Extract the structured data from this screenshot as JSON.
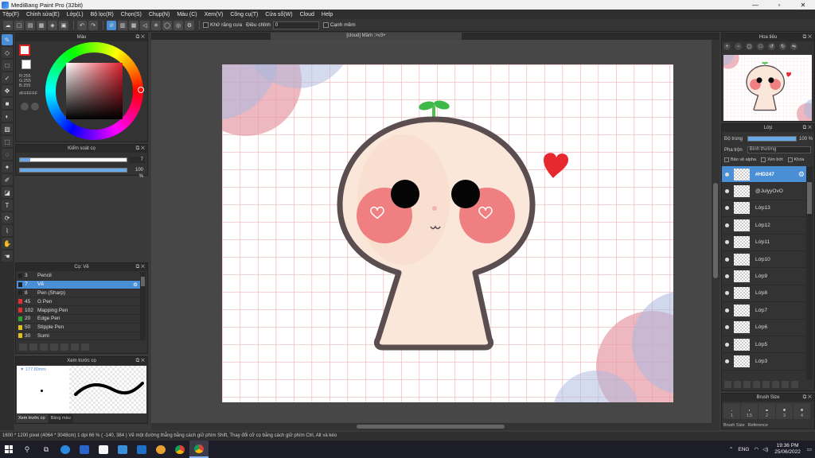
{
  "window": {
    "title": "MediBang Paint Pro (32bit)",
    "min": "—",
    "max": "▫",
    "close": "✕"
  },
  "menu": [
    "Tệp(F)",
    "Chỉnh sửa(E)",
    "Lớp(L)",
    "Bộ lọc(R)",
    "Chọn(S)",
    "Chụp(N)",
    "Màu (C)",
    "Xem(V)",
    "Công cụ(T)",
    "Cửa sổ(W)",
    "Cloud",
    "Help"
  ],
  "toolbar": {
    "antialias_label": "Khử răng cưa",
    "adjust_label": "Điều chỉnh",
    "adjust_value": "0",
    "edge_label": "Cạnh mềm"
  },
  "color_panel": {
    "title": "Màu",
    "rgb": [
      "R:255",
      "G:255",
      "B:255"
    ],
    "hex": "#FFFFFF",
    "fg_color": "#ffffff",
    "accent": "#e2202e"
  },
  "brush_control": {
    "title": "Kiểm soát cọ",
    "size_value": "7",
    "size_fraction": 0.1,
    "opacity_value": "100 %",
    "opacity_fraction": 1.0
  },
  "brush_list": {
    "title": "Cọ: Vẽ",
    "items": [
      {
        "size": "3",
        "name": "Pencil",
        "color": "#222222"
      },
      {
        "size": "7",
        "name": "Vẽ",
        "color": "#222222",
        "selected": true
      },
      {
        "size": "8",
        "name": "Pen (Sharp)",
        "color": "#222222"
      },
      {
        "size": "45",
        "name": "G Pen",
        "color": "#e03030"
      },
      {
        "size": "102",
        "name": "Mapping Pen",
        "color": "#e03030"
      },
      {
        "size": "20",
        "name": "Edge Pen",
        "color": "#30a030"
      },
      {
        "size": "50",
        "name": "Stipple Pen",
        "color": "#e0c020"
      },
      {
        "size": "30",
        "name": "Sumi",
        "color": "#e0c020"
      }
    ]
  },
  "brush_preview": {
    "title": "Xem trước cọ",
    "size": "177.80mm",
    "tabs": [
      "Xem trước cọ",
      "Bảng màu"
    ]
  },
  "canvas": {
    "tab_title": "[cloud] Mầm :>v3+",
    "status": "1600 * 1200 pixel   (4064 * 3048cm)   1 dpi   66 %   ( -140, 384 )   Vẽ một đường thẳng bằng cách giữ phím Shift, Thay đổi cỡ cọ bằng cách giữ phím Ctrl, Alt và kéo"
  },
  "navigator": {
    "title": "Hoa tiêu"
  },
  "layer_panel": {
    "title": "Lớp",
    "opacity_label": "Độ trong",
    "opacity_value": "100 %",
    "blend_label": "Pha trộn",
    "blend_value": "Bình thường",
    "protect_alpha": "Bảo vệ alpha",
    "clipping": "Xén bớt",
    "lock": "Khóa",
    "layers": [
      {
        "name": "#HD247",
        "selected": true
      },
      {
        "name": "@JulyyOvO"
      },
      {
        "name": "Lớp13"
      },
      {
        "name": "Lớp12"
      },
      {
        "name": "Lớp11"
      },
      {
        "name": "Lớp10"
      },
      {
        "name": "Lớp9"
      },
      {
        "name": "Lớp8"
      },
      {
        "name": "Lớp7"
      },
      {
        "name": "Lớp6"
      },
      {
        "name": "Lớp5"
      },
      {
        "name": "Lớp3"
      }
    ]
  },
  "brush_size": {
    "title": "Brush Size",
    "sizes": [
      "1",
      "1.5",
      "2",
      "3",
      "4"
    ],
    "tabs": [
      "Brush Size",
      "Reference"
    ]
  },
  "taskbar": {
    "lang": "ENG",
    "time": "19:36 PM",
    "date": "25/06/2022"
  }
}
